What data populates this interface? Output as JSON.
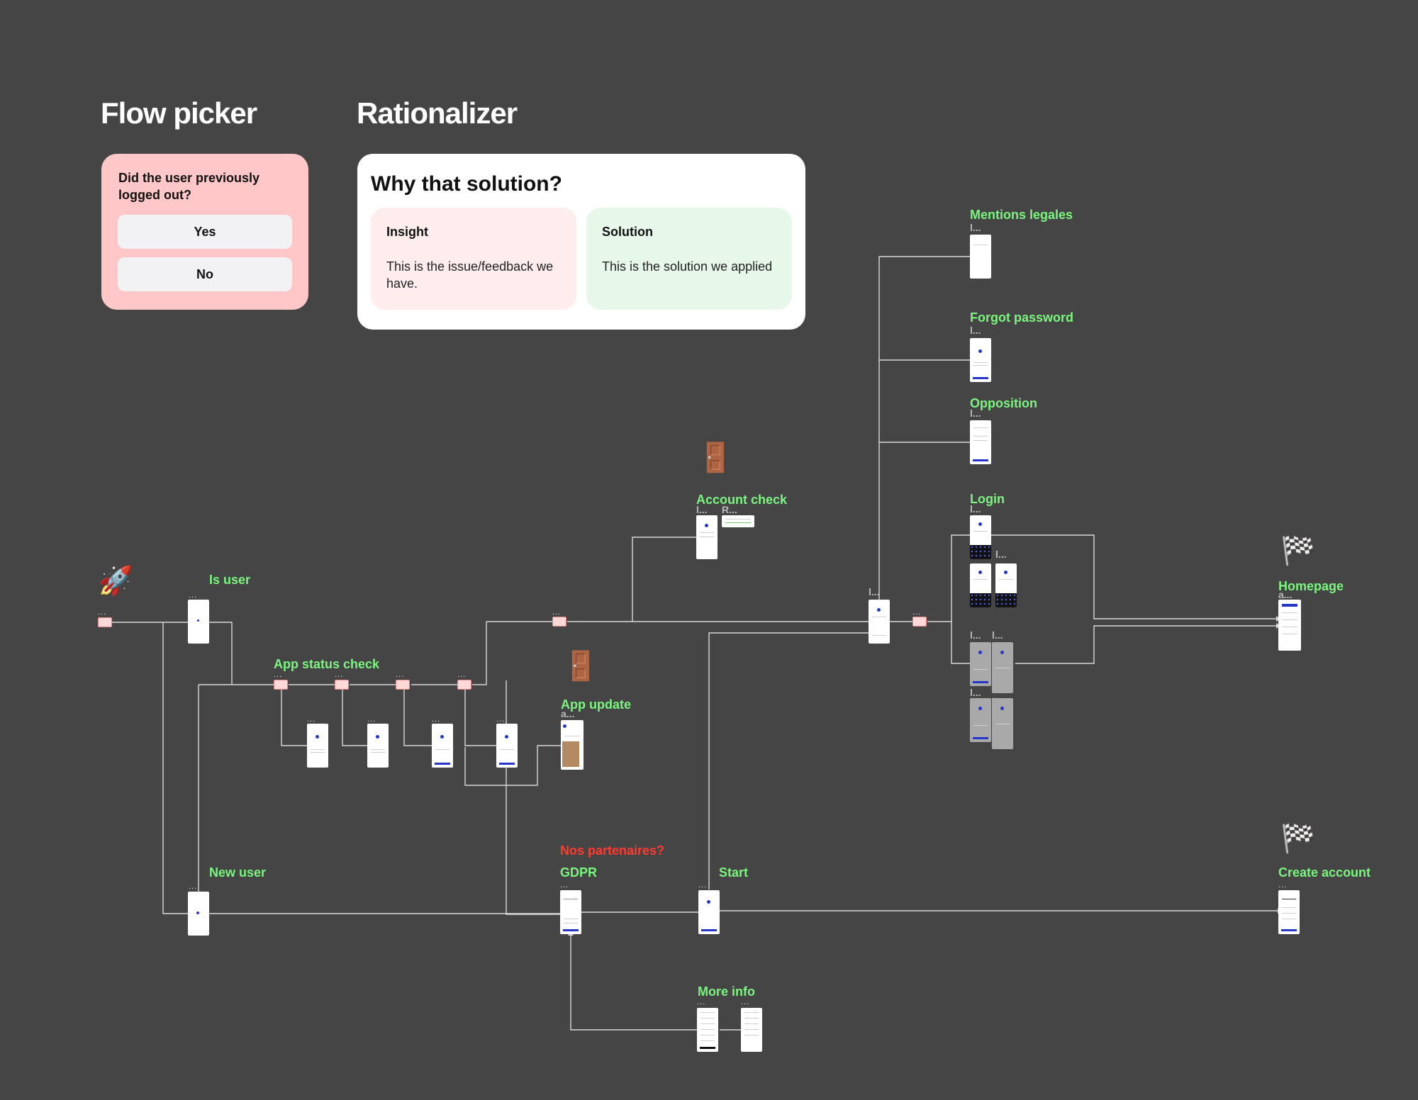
{
  "headings": {
    "flow_picker": "Flow picker",
    "rationalizer": "Rationalizer"
  },
  "flow_picker": {
    "question": "Did the user previously logged out?",
    "yes": "Yes",
    "no": "No"
  },
  "rationalizer": {
    "title": "Why that solution?",
    "insight_title": "Insight",
    "insight_text": "This is the issue/feedback we have.",
    "solution_title": "Solution",
    "solution_text": "This is the solution we applied",
    "insight_color": "#ffeded",
    "solution_color": "#e7f8ea"
  },
  "labels": {
    "mentions_legales": "Mentions legales",
    "forgot_password": "Forgot password",
    "opposition": "Opposition",
    "account_check": "Account check",
    "login": "Login",
    "is_user": "Is user",
    "homepage": "Homepage",
    "app_status_check": "App status check",
    "app_update": "App update",
    "nos_partenaires": "Nos partenaires?",
    "gdpr": "GDPR",
    "start": "Start",
    "new_user": "New user",
    "create_account": "Create account",
    "more_info": "More info"
  },
  "dots": "...",
  "tiny": {
    "l": "l...",
    "r": "R...",
    "a": "a...",
    "lp": "l..."
  },
  "colors": {
    "background": "#454545",
    "label_green": "#7bf57f",
    "label_red": "#ff3b30",
    "flow_card": "#ffc7c7",
    "accent_blue": "#2437c9"
  },
  "icons": {
    "rocket": "🚀",
    "door": "🚪",
    "flag": "🏁"
  }
}
